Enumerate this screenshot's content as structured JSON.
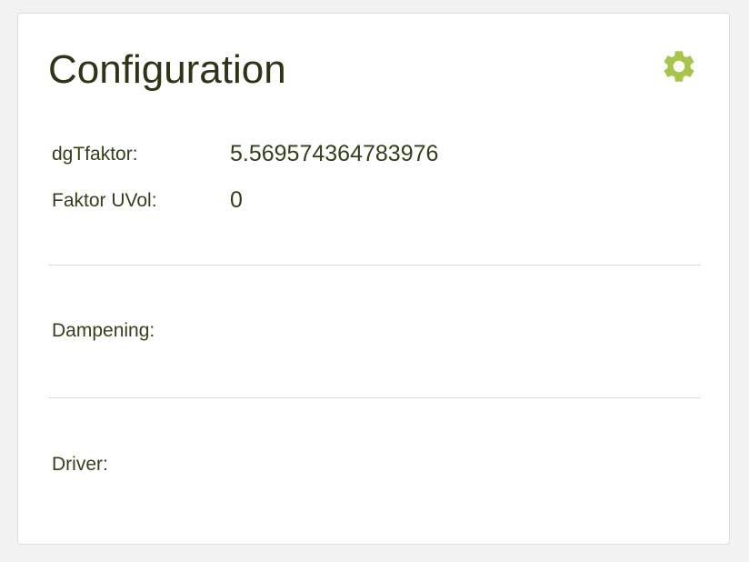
{
  "card": {
    "title": "Configuration",
    "settings_icon": "gear-icon",
    "accent_color": "#a7c44b"
  },
  "params": {
    "dgtfaktor": {
      "label": "dgTfaktor:",
      "value": "5.569574364783976"
    },
    "faktor_uvol": {
      "label": "Faktor UVol:",
      "value": "0"
    }
  },
  "dampening": {
    "label": "Dampening:"
  },
  "driver": {
    "label": "Driver:"
  }
}
